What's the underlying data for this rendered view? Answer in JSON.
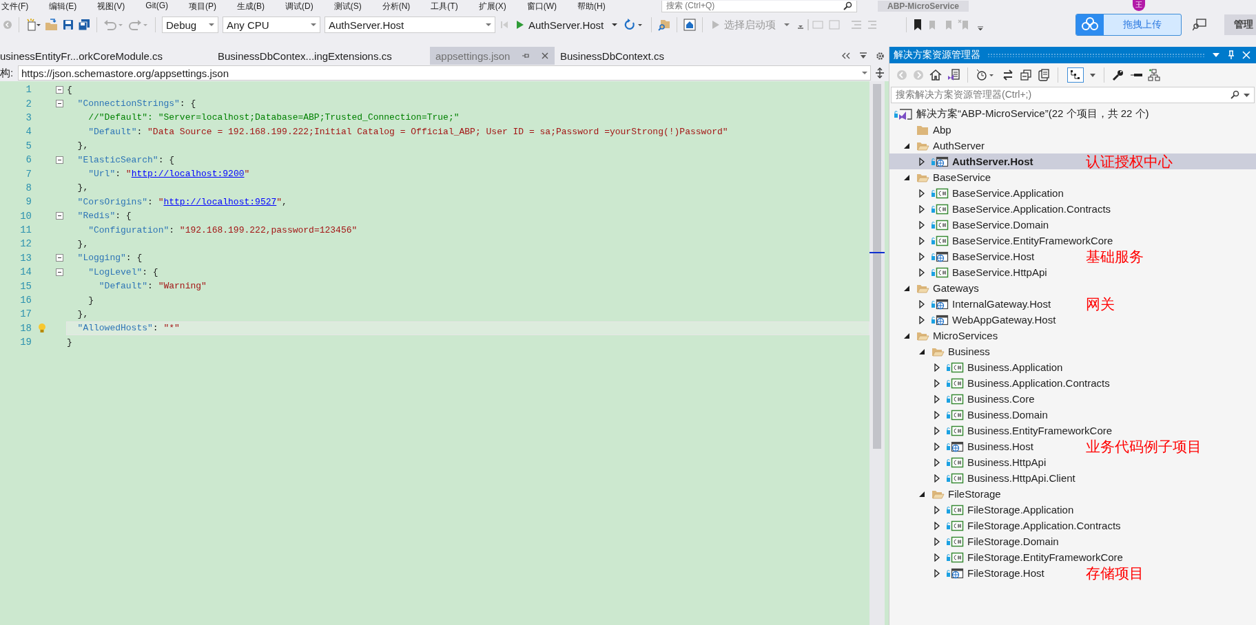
{
  "menu": [
    "文件(F)",
    "编辑(E)",
    "视图(V)",
    "Git(G)",
    "项目(P)",
    "生成(B)",
    "调试(D)",
    "测试(S)",
    "分析(N)",
    "工具(T)",
    "扩展(X)",
    "窗口(W)",
    "帮助(H)"
  ],
  "title_bar": {
    "search_placeholder": "搜索 (Ctrl+Q)",
    "title": "ABP-MicroService",
    "avatar": "王"
  },
  "toolbar": {
    "configuration": "Debug",
    "platform": "Any CPU",
    "startup_project": "AuthServer.Host",
    "run_label": "AuthServer.Host",
    "start_item": {
      "label": "选择启动项",
      "disabled": true
    },
    "upload_button": "拖拽上传",
    "admin_button": "管理"
  },
  "tabs": [
    {
      "label": "usinessEntityFr...orkCoreModule.cs",
      "selected": false
    },
    {
      "label": "BusinessDbContex...ingExtensions.cs",
      "selected": false
    },
    {
      "label": "appsettings.json",
      "selected": true
    },
    {
      "label": "BusinessDbContext.cs",
      "selected": false
    }
  ],
  "schema_bar": {
    "label": "构:",
    "value": "https://json.schemastore.org/appsettings.json"
  },
  "code": [
    {
      "number": "1",
      "foldable": true,
      "segments": [
        {
          "kind": "p",
          "text": "{"
        }
      ]
    },
    {
      "number": "2",
      "foldable": true,
      "segments": [
        {
          "kind": "key",
          "text": "  \"ConnectionStrings\""
        },
        {
          "kind": "p",
          "text": ": {"
        }
      ]
    },
    {
      "number": "3",
      "segments": [
        {
          "kind": "comment",
          "text": "    //\"Default\": \"Server=localhost;Database=ABP;Trusted_Connection=True;\""
        }
      ]
    },
    {
      "number": "4",
      "segments": [
        {
          "kind": "key",
          "text": "    \"Default\""
        },
        {
          "kind": "p",
          "text": ": "
        },
        {
          "kind": "str",
          "text": "\"Data Source = 192.168.199.222;Initial Catalog = Official_ABP; User ID = sa;Password =yourStrong(!)Password\""
        }
      ]
    },
    {
      "number": "5",
      "segments": [
        {
          "kind": "p",
          "text": "  },"
        }
      ]
    },
    {
      "number": "6",
      "foldable": true,
      "segments": [
        {
          "kind": "key",
          "text": "  \"ElasticSearch\""
        },
        {
          "kind": "p",
          "text": ": {"
        }
      ]
    },
    {
      "number": "7",
      "segments": [
        {
          "kind": "key",
          "text": "    \"Url\""
        },
        {
          "kind": "p",
          "text": ": "
        },
        {
          "kind": "str",
          "text": "\""
        },
        {
          "kind": "link",
          "text": "http://localhost:9200"
        },
        {
          "kind": "str",
          "text": "\""
        }
      ]
    },
    {
      "number": "8",
      "segments": [
        {
          "kind": "p",
          "text": "  },"
        }
      ]
    },
    {
      "number": "9",
      "segments": [
        {
          "kind": "key",
          "text": "  \"CorsOrigins\""
        },
        {
          "kind": "p",
          "text": ": "
        },
        {
          "kind": "str",
          "text": "\""
        },
        {
          "kind": "link",
          "text": "http://localhost:9527"
        },
        {
          "kind": "str",
          "text": "\""
        },
        {
          "kind": "p",
          "text": ","
        }
      ]
    },
    {
      "number": "10",
      "foldable": true,
      "segments": [
        {
          "kind": "key",
          "text": "  \"Redis\""
        },
        {
          "kind": "p",
          "text": ": {"
        }
      ]
    },
    {
      "number": "11",
      "segments": [
        {
          "kind": "key",
          "text": "    \"Configuration\""
        },
        {
          "kind": "p",
          "text": ": "
        },
        {
          "kind": "str",
          "text": "\"192.168.199.222,password=123456\""
        }
      ]
    },
    {
      "number": "12",
      "segments": [
        {
          "kind": "p",
          "text": "  },"
        }
      ]
    },
    {
      "number": "13",
      "foldable": true,
      "segments": [
        {
          "kind": "key",
          "text": "  \"Logging\""
        },
        {
          "kind": "p",
          "text": ": {"
        }
      ]
    },
    {
      "number": "14",
      "foldable": true,
      "segments": [
        {
          "kind": "key",
          "text": "    \"LogLevel\""
        },
        {
          "kind": "p",
          "text": ": {"
        }
      ]
    },
    {
      "number": "15",
      "segments": [
        {
          "kind": "key",
          "text": "      \"Default\""
        },
        {
          "kind": "p",
          "text": ": "
        },
        {
          "kind": "str",
          "text": "\"Warning\""
        }
      ]
    },
    {
      "number": "16",
      "segments": [
        {
          "kind": "p",
          "text": "    }"
        }
      ]
    },
    {
      "number": "17",
      "segments": [
        {
          "kind": "p",
          "text": "  },"
        }
      ]
    },
    {
      "number": "18",
      "current": true,
      "lightbulb": true,
      "segments": [
        {
          "kind": "key",
          "text": "  \"AllowedHosts\""
        },
        {
          "kind": "p",
          "text": ": "
        },
        {
          "kind": "str",
          "text": "\"*\""
        }
      ]
    },
    {
      "number": "19",
      "segments": [
        {
          "kind": "p",
          "text": "}"
        }
      ]
    }
  ],
  "solution_explorer": {
    "title": "解决方案资源管理器",
    "search_placeholder": "搜索解决方案资源管理器(Ctrl+;)",
    "tree": [
      {
        "label": "解决方案“ABP-MicroService”(22 个项目，共 22 个)",
        "kind": "solution",
        "selected": false,
        "children": [
          {
            "label": "Abp",
            "kind": "folder",
            "selected": false
          },
          {
            "label": "AuthServer",
            "kind": "folder",
            "expanded": true,
            "selected": false,
            "children": [
              {
                "label": "AuthServer.Host",
                "kind": "web",
                "expanded": false,
                "selected": true,
                "note": "认证授权中心"
              }
            ]
          },
          {
            "label": "BaseService",
            "kind": "folder",
            "expanded": true,
            "selected": false,
            "children": [
              {
                "label": "BaseService.Application",
                "kind": "csharp",
                "expanded": false,
                "selected": false
              },
              {
                "label": "BaseService.Application.Contracts",
                "kind": "csharp",
                "expanded": false,
                "selected": false
              },
              {
                "label": "BaseService.Domain",
                "kind": "csharp",
                "expanded": false,
                "selected": false
              },
              {
                "label": "BaseService.EntityFrameworkCore",
                "kind": "csharp",
                "expanded": false,
                "selected": false
              },
              {
                "label": "BaseService.Host",
                "kind": "web",
                "expanded": false,
                "selected": false,
                "note": "基础服务"
              },
              {
                "label": "BaseService.HttpApi",
                "kind": "csharp",
                "expanded": false,
                "selected": false
              }
            ]
          },
          {
            "label": "Gateways",
            "kind": "folder",
            "expanded": true,
            "selected": false,
            "children": [
              {
                "label": "InternalGateway.Host",
                "kind": "web",
                "expanded": false,
                "selected": false,
                "note": "网关"
              },
              {
                "label": "WebAppGateway.Host",
                "kind": "web",
                "expanded": false,
                "selected": false
              }
            ]
          },
          {
            "label": "MicroServices",
            "kind": "folder",
            "expanded": true,
            "selected": false,
            "children": [
              {
                "label": "Business",
                "kind": "folder",
                "expanded": true,
                "selected": false,
                "children": [
                  {
                    "label": "Business.Application",
                    "kind": "csharp",
                    "expanded": false,
                    "selected": false
                  },
                  {
                    "label": "Business.Application.Contracts",
                    "kind": "csharp",
                    "expanded": false,
                    "selected": false
                  },
                  {
                    "label": "Business.Core",
                    "kind": "csharp",
                    "expanded": false,
                    "selected": false
                  },
                  {
                    "label": "Business.Domain",
                    "kind": "csharp",
                    "expanded": false,
                    "selected": false
                  },
                  {
                    "label": "Business.EntityFrameworkCore",
                    "kind": "csharp",
                    "expanded": false,
                    "selected": false
                  },
                  {
                    "label": "Business.Host",
                    "kind": "web",
                    "expanded": false,
                    "selected": false,
                    "note": "业务代码例子项目"
                  },
                  {
                    "label": "Business.HttpApi",
                    "kind": "csharp",
                    "expanded": false,
                    "selected": false
                  },
                  {
                    "label": "Business.HttpApi.Client",
                    "kind": "csharp",
                    "expanded": false,
                    "selected": false
                  }
                ]
              },
              {
                "label": "FileStorage",
                "kind": "folder",
                "expanded": true,
                "selected": false,
                "children": [
                  {
                    "label": "FileStorage.Application",
                    "kind": "csharp",
                    "expanded": false,
                    "selected": false
                  },
                  {
                    "label": "FileStorage.Application.Contracts",
                    "kind": "csharp",
                    "expanded": false,
                    "selected": false
                  },
                  {
                    "label": "FileStorage.Domain",
                    "kind": "csharp",
                    "expanded": false,
                    "selected": false
                  },
                  {
                    "label": "FileStorage.EntityFrameworkCore",
                    "kind": "csharp",
                    "expanded": false,
                    "selected": false
                  },
                  {
                    "label": "FileStorage.Host",
                    "kind": "web",
                    "expanded": false,
                    "selected": false,
                    "note": "存储项目"
                  }
                ]
              }
            ]
          }
        ]
      }
    ]
  }
}
